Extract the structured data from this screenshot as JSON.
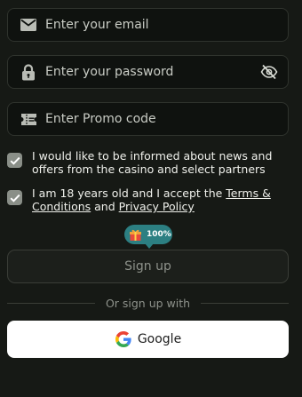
{
  "form": {
    "email": {
      "placeholder": "Enter your email",
      "value": "",
      "icon": "envelope-icon"
    },
    "password": {
      "placeholder": "Enter your password",
      "value": "",
      "icon": "lock-icon",
      "toggle_icon": "eye-off-icon"
    },
    "promo": {
      "placeholder": "Enter Promo code",
      "value": "",
      "icon": "ticket-icon"
    }
  },
  "consents": {
    "news": {
      "checked": true,
      "text": "I would like to be informed about news and offers from the casino and select partners"
    },
    "age": {
      "checked": true,
      "text_prefix": "I am 18 years old and I accept the ",
      "terms_link": "Terms & Conditions",
      "and_text": " and ",
      "privacy_link": "Privacy Policy"
    }
  },
  "progress_badge": {
    "icon": "gift-icon",
    "value": "100%"
  },
  "signup_button": {
    "label": "Sign up"
  },
  "divider": {
    "label": "Or sign up with"
  },
  "google_button": {
    "label": "Google",
    "icon": "google-icon"
  },
  "colors": {
    "background": "#161915",
    "field_background": "#0f120f",
    "badge": "#2c7f82",
    "checkbox": "#8a8f88",
    "signup_text": "#8e928b",
    "google_bg": "#ffffff"
  }
}
